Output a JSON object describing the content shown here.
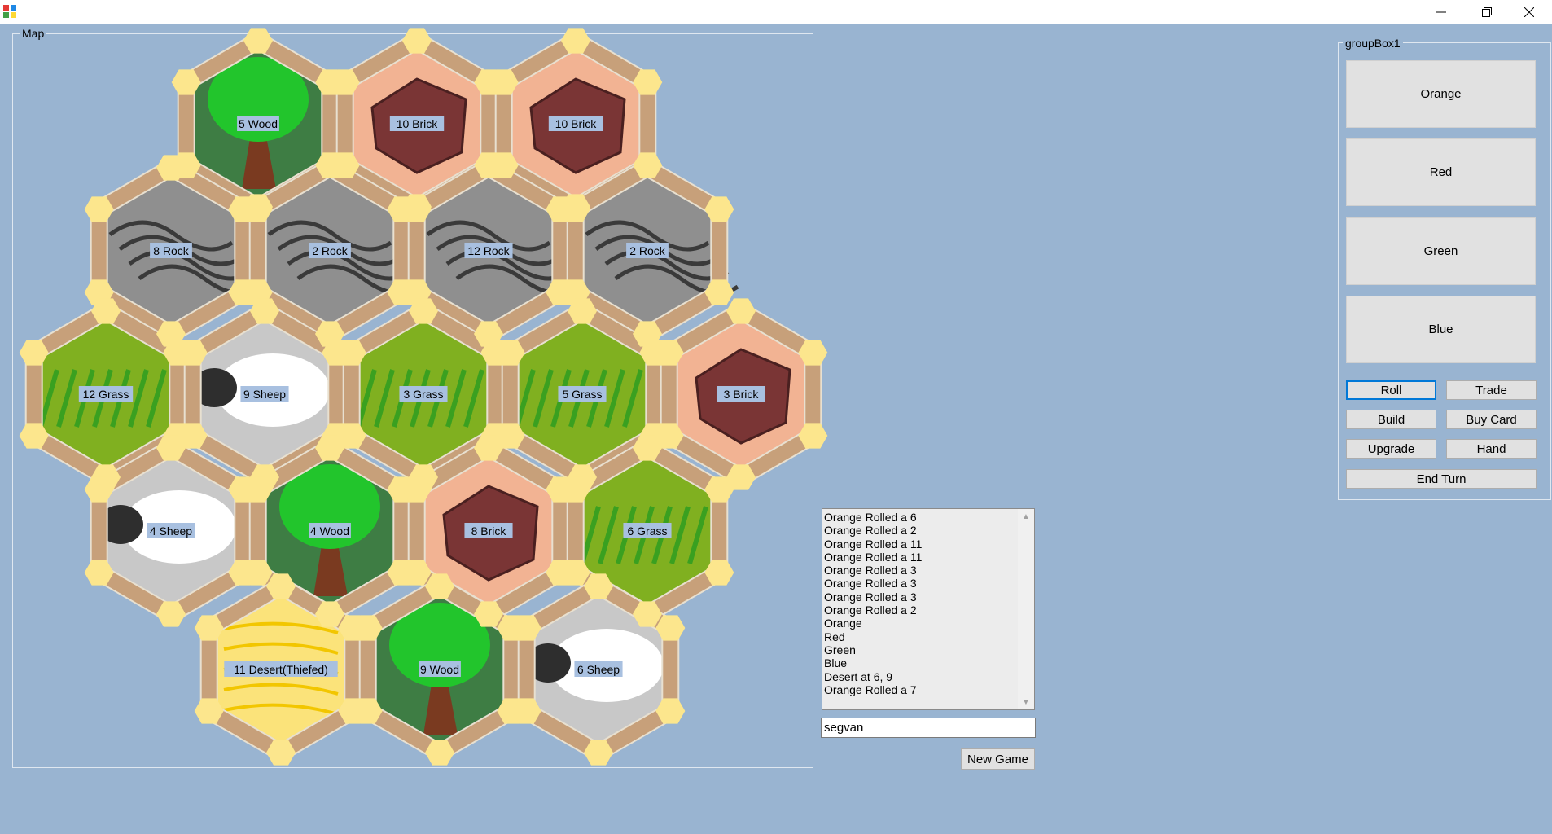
{
  "window": {
    "minimize_glyph": "—",
    "restore_glyph": "❐",
    "close_glyph": "✕",
    "icon": "app-icon"
  },
  "map": {
    "legend": "Map",
    "tiles": [
      {
        "label": "5 Wood",
        "type": "wood",
        "row": 0,
        "col": 0
      },
      {
        "label": "10 Brick",
        "type": "brick",
        "row": 0,
        "col": 1
      },
      {
        "label": "10 Brick",
        "type": "brick",
        "row": 0,
        "col": 2
      },
      {
        "label": "8 Rock",
        "type": "rock",
        "row": 1,
        "col": 0
      },
      {
        "label": "2 Rock",
        "type": "rock",
        "row": 1,
        "col": 1
      },
      {
        "label": "12 Rock",
        "type": "rock",
        "row": 1,
        "col": 2
      },
      {
        "label": "2 Rock",
        "type": "rock",
        "row": 1,
        "col": 3
      },
      {
        "label": "12 Grass",
        "type": "grass",
        "row": 2,
        "col": 0
      },
      {
        "label": "9 Sheep",
        "type": "sheep",
        "row": 2,
        "col": 1
      },
      {
        "label": "3 Grass",
        "type": "grass",
        "row": 2,
        "col": 2
      },
      {
        "label": "5 Grass",
        "type": "grass",
        "row": 2,
        "col": 3
      },
      {
        "label": "3 Brick",
        "type": "brick",
        "row": 2,
        "col": 4
      },
      {
        "label": "4 Sheep",
        "type": "sheep",
        "row": 3,
        "col": 0
      },
      {
        "label": "4 Wood",
        "type": "wood",
        "row": 3,
        "col": 1
      },
      {
        "label": "8 Brick",
        "type": "brick",
        "row": 3,
        "col": 2
      },
      {
        "label": "6 Grass",
        "type": "grass",
        "row": 3,
        "col": 3
      },
      {
        "label": "11 Desert(Thiefed)",
        "type": "desert",
        "row": 4,
        "col": 0
      },
      {
        "label": "9 Wood",
        "type": "wood",
        "row": 4,
        "col": 1
      },
      {
        "label": "6 Sheep",
        "type": "sheep",
        "row": 4,
        "col": 2
      }
    ]
  },
  "groupbox": {
    "legend": "groupBox1",
    "players": [
      {
        "label": "Orange"
      },
      {
        "label": "Red"
      },
      {
        "label": "Green"
      },
      {
        "label": "Blue"
      }
    ],
    "actions": {
      "roll": "Roll",
      "trade": "Trade",
      "build": "Build",
      "buy_card": "Buy Card",
      "upgrade": "Upgrade",
      "hand": "Hand",
      "end_turn": "End Turn"
    }
  },
  "log": {
    "entries": [
      "Orange Rolled a 6",
      "Orange Rolled a 2",
      "Orange Rolled a 11",
      "Orange Rolled a 11",
      "Orange Rolled a 3",
      "Orange Rolled a 3",
      "Orange Rolled a 3",
      "Orange Rolled a 2",
      "Orange",
      "Red",
      "Green",
      "Blue",
      "Desert at 6, 9",
      "Orange Rolled a 7"
    ]
  },
  "name_input": {
    "value": "segvan"
  },
  "new_game_button": {
    "label": "New Game"
  },
  "colors": {
    "background": "#99b4d1",
    "button": "#e1e1e1",
    "wood": "#3e7d44",
    "wood_canopy": "#22c52c",
    "brick": "#f2b393",
    "brick_stone": "#7a3535",
    "rock": "#8f8f8f",
    "grass": "#80b020",
    "sheep": "#c8c8c8",
    "desert": "#fbe37a",
    "settlement": "#fce68d",
    "road": "#c7a07a",
    "tile_label_bg": "#a8c0e0"
  }
}
